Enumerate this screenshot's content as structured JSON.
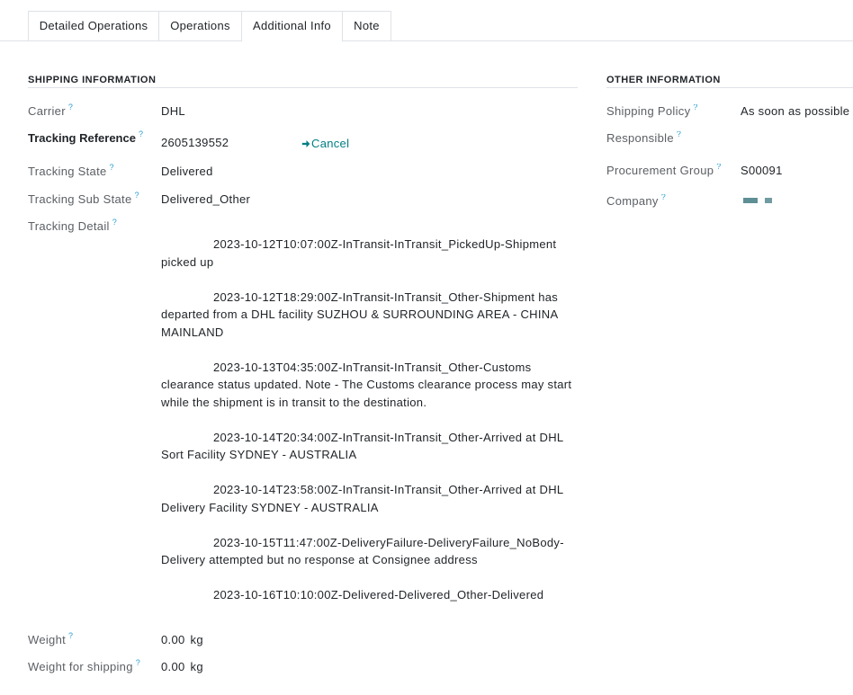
{
  "colors": {
    "text": "#212529",
    "label": "#5b5f64",
    "accent": "#017e84",
    "help": "#2a9fd0",
    "border": "#dee2e6",
    "redaction_1": "#5e8f95",
    "redaction_2": "#709ca1"
  },
  "tabs": [
    {
      "label": "Detailed Operations",
      "active": false
    },
    {
      "label": "Operations",
      "active": false
    },
    {
      "label": "Additional Info",
      "active": true
    },
    {
      "label": "Note",
      "active": false
    }
  ],
  "shipping": {
    "title": "SHIPPING INFORMATION",
    "carrier": {
      "label": "Carrier",
      "help": "?",
      "value": "DHL"
    },
    "tracking_reference": {
      "label": "Tracking Reference",
      "help": "?",
      "value": "2605139552",
      "cancel_label": "Cancel",
      "cancel_icon": "arrow-right-icon"
    },
    "tracking_state": {
      "label": "Tracking State",
      "help": "?",
      "value": "Delivered"
    },
    "tracking_sub_state": {
      "label": "Tracking Sub State",
      "help": "?",
      "value": "Delivered_Other"
    },
    "tracking_detail": {
      "label": "Tracking Detail",
      "help": "?",
      "entries": [
        "2023-10-12T10:07:00Z-InTransit-InTransit_PickedUp-Shipment picked up",
        "2023-10-12T18:29:00Z-InTransit-InTransit_Other-Shipment has departed from a DHL facility SUZHOU & SURROUNDING AREA - CHINA MAINLAND",
        "2023-10-13T04:35:00Z-InTransit-InTransit_Other-Customs clearance status updated. Note - The Customs clearance process may start while the shipment is in transit to the destination.",
        "2023-10-14T20:34:00Z-InTransit-InTransit_Other-Arrived at DHL Sort Facility SYDNEY - AUSTRALIA",
        "2023-10-14T23:58:00Z-InTransit-InTransit_Other-Arrived at DHL Delivery Facility SYDNEY - AUSTRALIA",
        "2023-10-15T11:47:00Z-DeliveryFailure-DeliveryFailure_NoBody-Delivery attempted but no response at Consignee address",
        "2023-10-16T10:10:00Z-Delivered-Delivered_Other-Delivered"
      ]
    },
    "weight": {
      "label": "Weight",
      "help": "?",
      "value": "0.00",
      "unit": "kg"
    },
    "weight_for_shipping": {
      "label": "Weight for shipping",
      "help": "?",
      "value": "0.00",
      "unit": "kg"
    }
  },
  "other": {
    "title": "OTHER INFORMATION",
    "shipping_policy": {
      "label": "Shipping Policy",
      "help": "?",
      "value": "As soon as possible"
    },
    "responsible": {
      "label": "Responsible",
      "help": "?"
    },
    "procurement_group": {
      "label": "Procurement Group",
      "help": "?",
      "value": "S00091"
    },
    "company": {
      "label": "Company",
      "help": "?"
    }
  }
}
